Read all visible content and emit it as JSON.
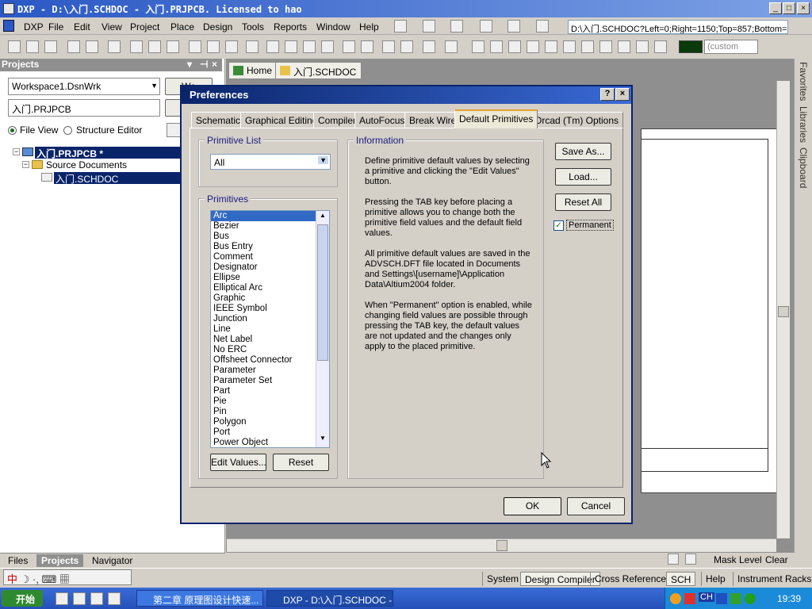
{
  "window": {
    "title": "DXP - D:\\入门.SCHDOC - 入门.PRJPCB. Licensed to hao"
  },
  "menu": [
    "DXP",
    "File",
    "Edit",
    "View",
    "Project",
    "Place",
    "Design",
    "Tools",
    "Reports",
    "Window",
    "Help"
  ],
  "toolbar": {
    "path_field": "D:\\入门.SCHDOC?Left=0;Right=1150;Top=857;Bottom=0",
    "custom_field": "(custom"
  },
  "projects_panel": {
    "title": "Projects",
    "workspace": "Workspace1.DsnWrk",
    "workspace_btn": "Wo",
    "project": "入门.PRJPCB",
    "project_btn": "P",
    "view_file": "File View",
    "view_structure": "Structure Editor",
    "tree": {
      "project": "入门.PRJPCB *",
      "folder": "Source Documents",
      "doc": "入门.SCHDOC"
    },
    "tabs": [
      "Files",
      "Projects",
      "Navigator"
    ]
  },
  "doc_tabs": [
    "Home",
    "入门.SCHDOC"
  ],
  "side_tabs": [
    "Favorites",
    "Libraries",
    "Clipboard"
  ],
  "status_right": {
    "mask_level": "Mask Level",
    "clear": "Clear"
  },
  "status_buttons": [
    "System",
    "Design Compiler",
    "Cross References",
    "SCH",
    "Help",
    "Instrument Racks"
  ],
  "ime": "中",
  "taskbar": {
    "start": "开始",
    "tasks": [
      "第二章 原理图设计快速...",
      "DXP - D:\\入门.SCHDOC - ..."
    ],
    "clock": "19:39",
    "tray_label": "CH"
  },
  "dialog": {
    "title": "Preferences",
    "tabs": [
      "Schematic",
      "Graphical Editing",
      "Compiler",
      "AutoFocus",
      "Break Wire",
      "Default Primitives",
      "Orcad (Tm) Options"
    ],
    "primitive_list_label": "Primitive List",
    "primitive_list_value": "All",
    "primitives_label": "Primitives",
    "primitives": [
      "Arc",
      "Bezier",
      "Bus",
      "Bus Entry",
      "Comment",
      "Designator",
      "Ellipse",
      "Elliptical Arc",
      "Graphic",
      "IEEE Symbol",
      "Junction",
      "Line",
      "Net Label",
      "No ERC",
      "Offsheet Connector",
      "Parameter",
      "Parameter Set",
      "Part",
      "Pie",
      "Pin",
      "Polygon",
      "Port",
      "Power Object"
    ],
    "selected_primitive": "Arc",
    "edit_values_btn": "Edit Values...",
    "reset_btn": "Reset",
    "information_label": "Information",
    "info": [
      "Define primitive default values by selecting a primitive and clicking the \"Edit Values\" button.",
      "Pressing the TAB key before placing a primitive allows you to change both the primitive field values and the default field values.",
      "All primitive default values are saved in the ADVSCH.DFT file located in Documents and Settings\\[username]\\Application Data\\Altium2004 folder.",
      "When \"Permanent\" option is enabled, while changing field values are possible through pressing the TAB key, the default values are not updated and the changes only apply to the placed primitive."
    ],
    "save_as_btn": "Save As...",
    "load_btn": "Load...",
    "reset_all_btn": "Reset All",
    "permanent_label": "Permanent",
    "permanent_checked": true,
    "ok_btn": "OK",
    "cancel_btn": "Cancel"
  }
}
